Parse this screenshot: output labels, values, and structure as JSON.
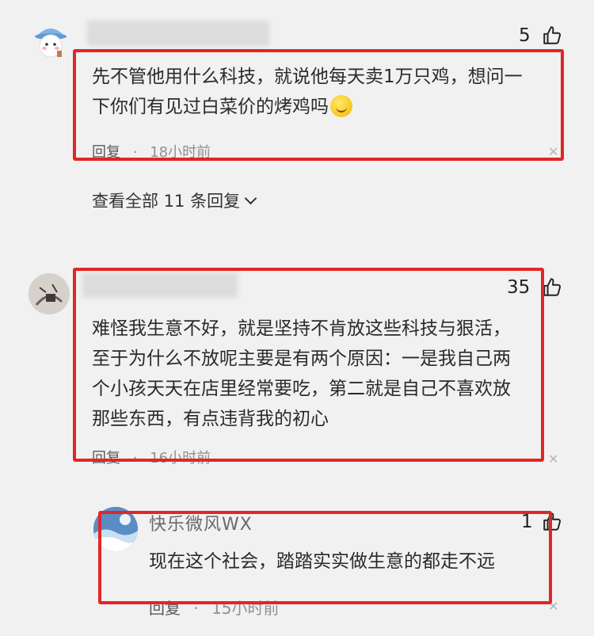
{
  "comments": [
    {
      "like_count": "5",
      "text_line1": "先不管他用什么科技，就说他每天卖1万只鸡，想问一",
      "text_line2": "下你们有见过白菜价的烤鸡吗",
      "reply_label": "回复",
      "time": "18小时前",
      "view_all": "查看全部 11 条回复"
    },
    {
      "like_count": "35",
      "text_lines": [
        "难怪我生意不好，就是坚持不肯放这些科技与狠活，",
        "至于为什么不放呢主要是有两个原因：一是我自己两",
        "个小孩天天在店里经常要吃，第二就是自己不喜欢放",
        "那些东西，有点违背我的初心"
      ],
      "reply_label": "回复",
      "time": "16小时前"
    },
    {
      "username": "快乐微风WX",
      "like_count": "1",
      "text": "现在这个社会，踏踏实实做生意的都走不远",
      "reply_label": "回复",
      "time": "15小时前"
    }
  ],
  "colors": {
    "highlight_border": "#e22626",
    "background": "#f1f1f1"
  },
  "icons": [
    "thumbs-up-icon",
    "close-icon",
    "chevron-down-icon",
    "smile-emoji-icon"
  ]
}
